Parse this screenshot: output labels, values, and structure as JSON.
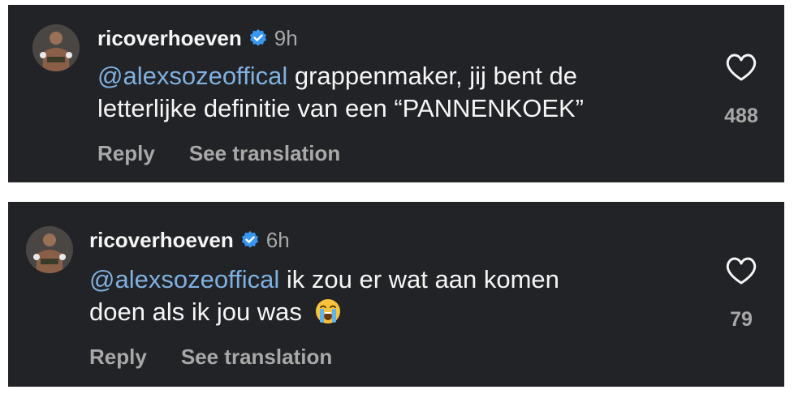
{
  "comments": [
    {
      "username": "ricoverhoeven",
      "timestamp": "9h",
      "mention": "@alexsozeoffical",
      "text_line1": " grappenmaker, jij bent de",
      "text_line2": "letterlijke definitie van een “PANNENKOEK”",
      "like_count": "488",
      "reply_label": "Reply",
      "translate_label": "See translation"
    },
    {
      "username": "ricoverhoeven",
      "timestamp": "6h",
      "mention": "@alexsozeoffical",
      "text_line1": " ik zou er wat aan komen",
      "text_line2": "doen als ik jou was",
      "emoji": "loudly-crying-face",
      "like_count": "79",
      "reply_label": "Reply",
      "translate_label": "See translation"
    }
  ],
  "colors": {
    "card_background": "#222326",
    "mention": "#7fb0e0",
    "verified_badge": "#3897f0",
    "secondary_text": "#a8a8a8"
  },
  "icons": {
    "verified": "verified-badge-icon",
    "like": "heart-outline-icon",
    "avatar": "profile-photo"
  }
}
